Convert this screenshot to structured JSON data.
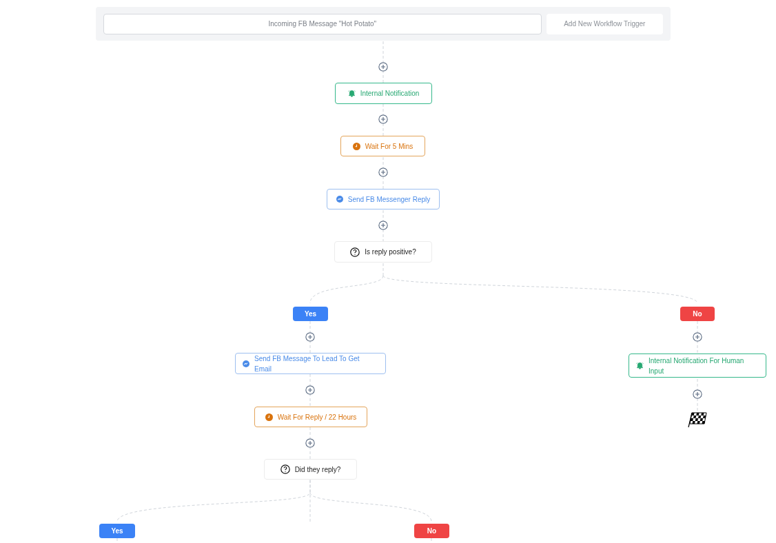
{
  "trigger": {
    "label": "Incoming FB Message \"Hot Potato\"",
    "add_button": "Add New Workflow Trigger"
  },
  "nodes": [
    {
      "kind": "notification",
      "label": "Internal Notification"
    },
    {
      "kind": "wait",
      "label": "Wait For 5 Mins"
    },
    {
      "kind": "messenger",
      "label": "Send FB Messenger Reply"
    },
    {
      "kind": "condition",
      "label": "Is reply positive?"
    },
    {
      "kind": "yes",
      "label": "Yes"
    },
    {
      "kind": "no",
      "label": "No"
    },
    {
      "kind": "messenger",
      "label": "Send FB Message To Lead To Get Email"
    },
    {
      "kind": "notification",
      "label": "Internal Notification For Human Input"
    },
    {
      "kind": "wait",
      "label": "Wait For Reply / 22 Hours"
    },
    {
      "kind": "condition",
      "label": "Did they reply?"
    },
    {
      "kind": "yes",
      "label": "Yes"
    },
    {
      "kind": "no",
      "label": "No"
    }
  ]
}
